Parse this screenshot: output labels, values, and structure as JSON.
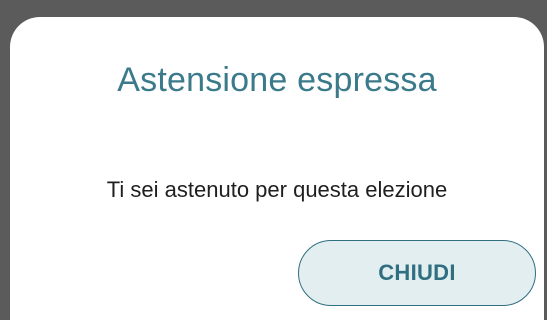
{
  "dialog": {
    "title": "Astensione espressa",
    "message": "Ti sei astenuto per questa elezione",
    "close_label": "CHIUDI"
  },
  "colors": {
    "backdrop": "#5b5b5b",
    "dialog_background": "#ffffff",
    "title": "#3a7a8a",
    "message": "#1f1f1f",
    "button_background": "#e3eef1",
    "button_border": "#2f6f80",
    "button_text": "#2f6f80"
  }
}
